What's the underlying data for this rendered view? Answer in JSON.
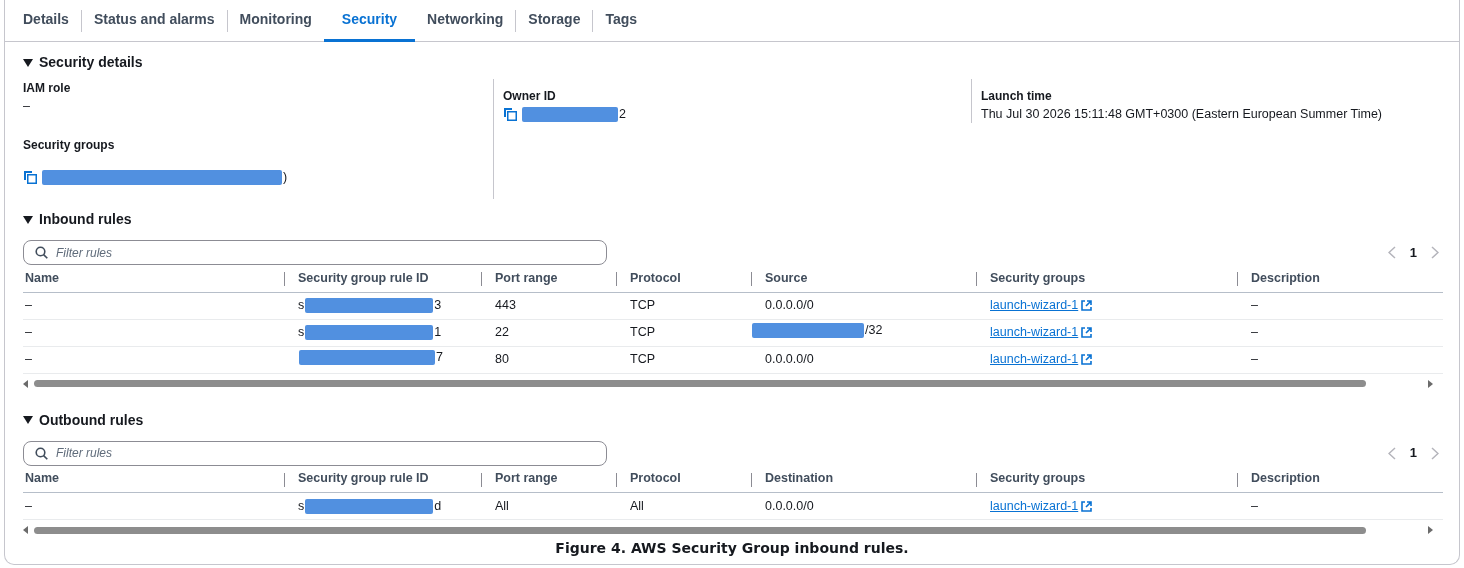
{
  "tabs": [
    {
      "label": "Details",
      "selected": false
    },
    {
      "label": "Status and alarms",
      "selected": false
    },
    {
      "label": "Monitoring",
      "selected": false
    },
    {
      "label": "Security",
      "selected": true
    },
    {
      "label": "Networking",
      "selected": false
    },
    {
      "label": "Storage",
      "selected": false
    },
    {
      "label": "Tags",
      "selected": false
    }
  ],
  "security_details": {
    "title": "Security details",
    "expanded": true,
    "iam_role": {
      "label": "IAM role",
      "value": "–"
    },
    "security_groups": {
      "label": "Security groups",
      "value": {
        "suffix": ")",
        "redacted": true
      }
    },
    "owner_id": {
      "label": "Owner ID",
      "value": {
        "suffix": "2",
        "redacted": true
      }
    },
    "launch_time": {
      "label": "Launch time",
      "value": "Thu Jul 30 2026 15:11:48 GMT+0300 (Eastern European Summer Time)"
    }
  },
  "inbound_rules": {
    "title": "Inbound rules",
    "expanded": true,
    "filter": {
      "placeholder": "Filter rules"
    },
    "page": "1",
    "columns": [
      "Name",
      "Security group rule ID",
      "Port range",
      "Protocol",
      "Source",
      "Security groups",
      "Description"
    ],
    "rows": [
      {
        "name": "–",
        "rule_id": {
          "prefix": "s",
          "suffix": "3",
          "redacted": true
        },
        "port_range": "443",
        "protocol": "TCP",
        "source": {
          "text": "0.0.0.0/0"
        },
        "security_group": "launch-wizard-1",
        "description": "–"
      },
      {
        "name": "–",
        "rule_id": {
          "prefix": "s",
          "suffix": "1",
          "redacted": true
        },
        "port_range": "22",
        "protocol": "TCP",
        "source": {
          "text": "/32",
          "redacted": true
        },
        "security_group": "launch-wizard-1",
        "description": "–"
      },
      {
        "name": "–",
        "rule_id": {
          "suffix": "7",
          "redacted": true
        },
        "port_range": "80",
        "protocol": "TCP",
        "source": {
          "text": "0.0.0.0/0"
        },
        "security_group": "launch-wizard-1",
        "description": "–"
      }
    ]
  },
  "outbound_rules": {
    "title": "Outbound rules",
    "expanded": true,
    "filter": {
      "placeholder": "Filter rules"
    },
    "page": "1",
    "columns": [
      "Name",
      "Security group rule ID",
      "Port range",
      "Protocol",
      "Destination",
      "Security groups",
      "Description"
    ],
    "rows": [
      {
        "name": "–",
        "rule_id": {
          "prefix": "s",
          "suffix": "d",
          "redacted": true
        },
        "port_range": "All",
        "protocol": "All",
        "source": {
          "text": "0.0.0.0/0"
        },
        "security_group": "launch-wizard-1",
        "description": "–"
      }
    ]
  },
  "caption": "Figure 4. AWS Security Group inbound rules."
}
